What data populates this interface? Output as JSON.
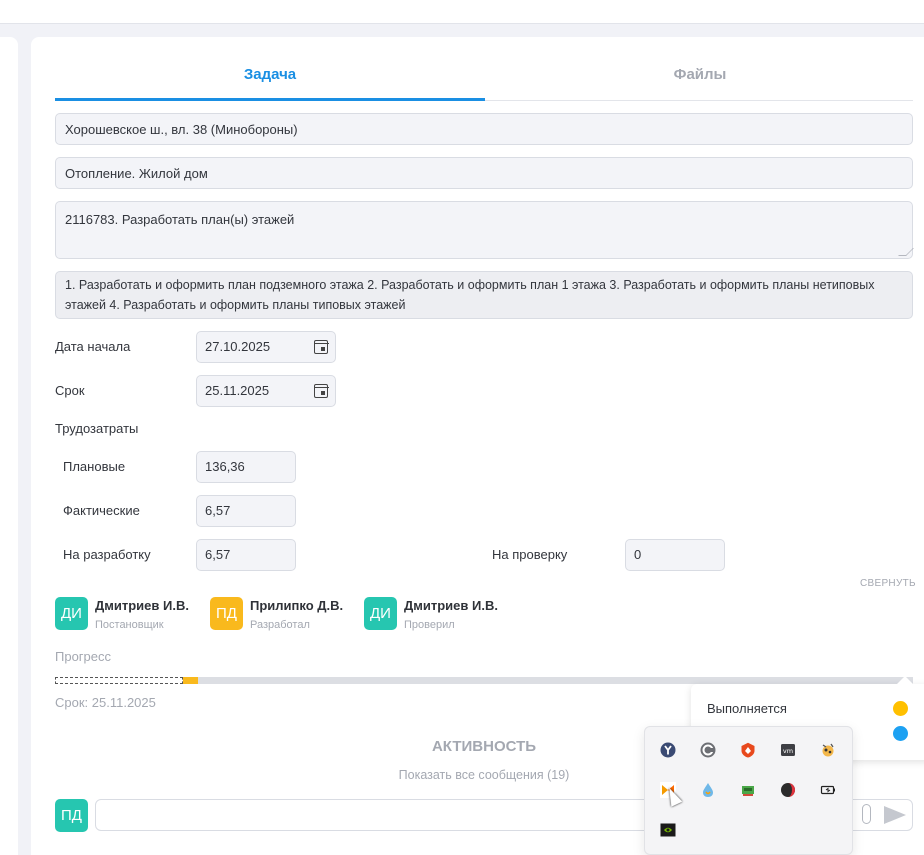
{
  "tabs": {
    "task": "Задача",
    "files": "Файлы"
  },
  "fields": {
    "address": "Хорошевское ш., вл. 38 (Минобороны)",
    "section": "Отопление. Жилой дом",
    "title": "2116783. Разработать план(ы) этажей",
    "description": "1. Разработать и оформить план подземного этажа 2. Разработать и оформить план 1 этажа 3. Разработать и оформить планы нетиповых этажей 4. Разработать и оформить планы типовых этажей"
  },
  "dates": {
    "start_label": "Дата начала",
    "start_value": "27.10.2025",
    "due_label": "Срок",
    "due_value": "25.11.2025"
  },
  "labor": {
    "title": "Трудозатраты",
    "planned_label": "Плановые",
    "planned_value": "136,36",
    "actual_label": "Фактические",
    "actual_value": "6,57",
    "dev_label": "На разработку",
    "dev_value": "6,57",
    "review_label": "На проверку",
    "review_value": "0",
    "collapse_label": "СВЕРНУТЬ"
  },
  "people": [
    {
      "initials": "ДИ",
      "name": "Дмитриев И.В.",
      "role": "Постановщик",
      "color": "#26c6b0"
    },
    {
      "initials": "ПД",
      "name": "Прилипко Д.В.",
      "role": "Разработал",
      "color": "#f9b91d"
    },
    {
      "initials": "ДИ",
      "name": "Дмитриев И.В.",
      "role": "Проверил",
      "color": "#26c6b0"
    }
  ],
  "progress": {
    "label": "Прогресс",
    "deadline": "Срок: 25.11.2025",
    "fraction": 0.167
  },
  "activity": {
    "title": "АКТИВНОСТЬ",
    "show_all": "Показать все сообщения (19)"
  },
  "chat": {
    "avatar_initials": "ПД",
    "placeholder": ""
  },
  "status_popup": {
    "label": "Выполняется",
    "dot_colors": [
      "#ffc000",
      "#1da1f2"
    ]
  },
  "tray_icons": [
    "yandex-browser-icon",
    "ccleaner-icon",
    "security-shield-icon",
    "vmware-icon",
    "paint-tool-icon",
    "media-player-icon",
    "water-drop-icon",
    "network-adapter-icon",
    "opera-gx-icon",
    "battery-icon",
    "nvidia-icon"
  ],
  "colors": {
    "accent": "#1a8fe3",
    "teal": "#26c6b0",
    "yellow": "#f9b91d"
  }
}
